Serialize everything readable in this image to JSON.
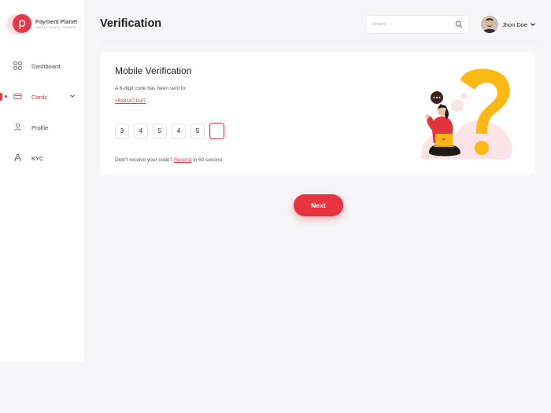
{
  "brand": {
    "logo_letter": "p",
    "name": "Payment Planet",
    "tagline": "CARDS | TRAVEL | PAYMENT",
    "accent": "#e23a46"
  },
  "sidebar": {
    "items": [
      {
        "label": "Dashboard",
        "icon": "grid-icon",
        "active": false
      },
      {
        "label": "Cards",
        "icon": "card-icon",
        "active": true
      },
      {
        "label": "Profile",
        "icon": "user-icon",
        "active": false
      },
      {
        "label": "KYC",
        "icon": "kyc-icon",
        "active": false
      }
    ]
  },
  "header": {
    "title": "Verification",
    "search_placeholder": "Search",
    "user_name": "Jhon Doe"
  },
  "verification": {
    "title": "Mobile Verification",
    "subtitle": "A 6-digit code has been sent to",
    "phone": "+6581671167",
    "otp_digits": [
      "3",
      "4",
      "5",
      "4",
      "5",
      ""
    ],
    "resend_prefix": "Didn't receive your code?",
    "resend_link": "Resend",
    "resend_suffix": " in 60 second"
  },
  "actions": {
    "next_label": "Next"
  }
}
